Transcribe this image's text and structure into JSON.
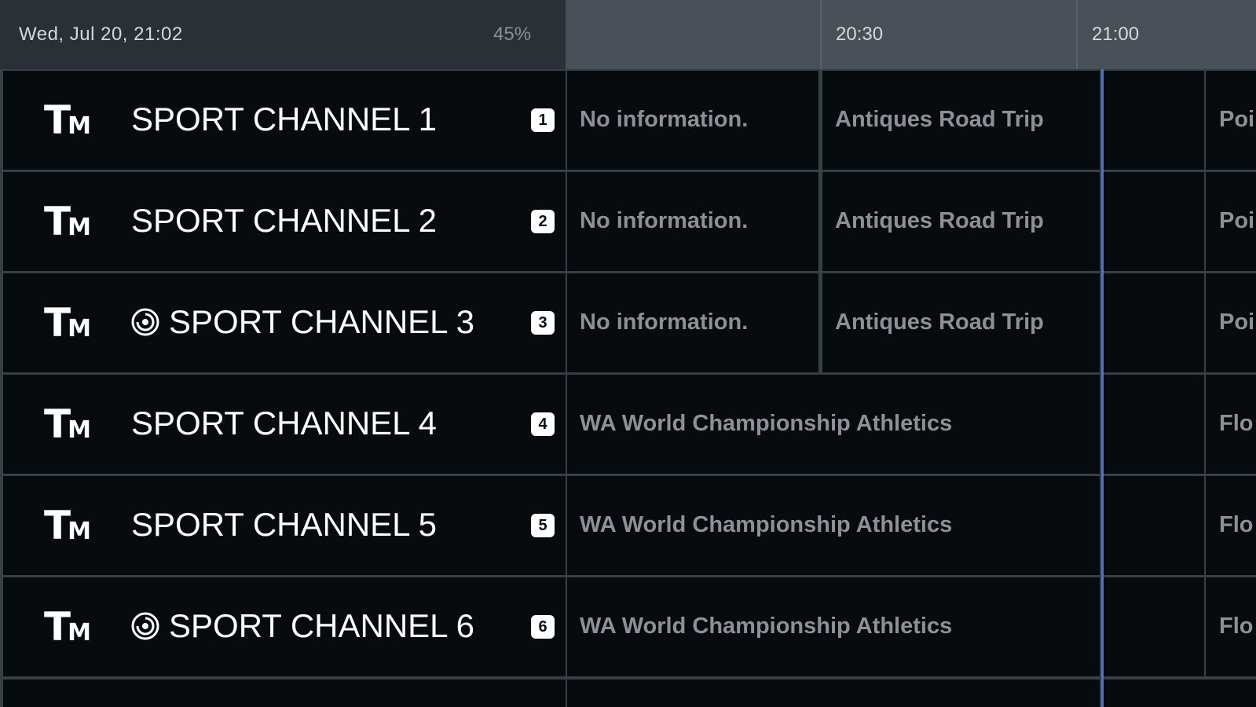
{
  "header": {
    "datetime": "Wed, Jul 20, 21:02",
    "battery": "45%",
    "time_slots": [
      "20:30",
      "21:00"
    ]
  },
  "channels": [
    {
      "logo": "TM",
      "name": "SPORT CHANNEL 1",
      "number": "1",
      "recording_icon": false,
      "programs": [
        "No information.",
        "Antiques Road Trip",
        "Poi"
      ]
    },
    {
      "logo": "TM",
      "name": "SPORT CHANNEL 2",
      "number": "2",
      "recording_icon": false,
      "programs": [
        "No information.",
        "Antiques Road Trip",
        "Poi"
      ]
    },
    {
      "logo": "TM",
      "name": "SPORT CHANNEL 3",
      "number": "3",
      "recording_icon": true,
      "programs": [
        "No information.",
        "Antiques Road Trip",
        "Poi"
      ]
    },
    {
      "logo": "TM",
      "name": "SPORT CHANNEL 4",
      "number": "4",
      "recording_icon": false,
      "programs": [
        "WA World Championship Athletics",
        "Flo"
      ]
    },
    {
      "logo": "TM",
      "name": "SPORT CHANNEL 5",
      "number": "5",
      "recording_icon": false,
      "programs": [
        "WA World Championship Athletics",
        "Flo"
      ]
    },
    {
      "logo": "TM",
      "name": "SPORT CHANNEL 6",
      "number": "6",
      "recording_icon": true,
      "programs": [
        "WA World Championship Athletics",
        "Flo"
      ]
    }
  ],
  "icons": {
    "recording": "recording-icon"
  },
  "colors": {
    "now_line": "#4a78c8",
    "cell_bg": "#070b0d",
    "header_bg": "#2b3036"
  }
}
